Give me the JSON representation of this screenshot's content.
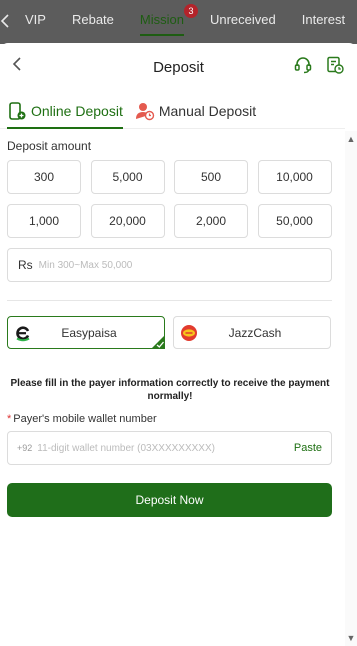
{
  "topnav": {
    "back_icon": "chevron-left-icon",
    "tabs": [
      {
        "label": "VIP"
      },
      {
        "label": "Rebate"
      },
      {
        "label": "Mission",
        "badge": "3",
        "active": true
      },
      {
        "label": "Unreceived"
      },
      {
        "label": "Interest"
      }
    ]
  },
  "header": {
    "title": "Deposit",
    "icons": [
      "headset-icon",
      "history-icon"
    ]
  },
  "method_tabs": [
    {
      "label": "Online Deposit",
      "icon": "online-deposit-icon",
      "active": true
    },
    {
      "label": "Manual Deposit",
      "icon": "manual-deposit-icon",
      "active": false
    }
  ],
  "amount": {
    "label": "Deposit amount",
    "presets": [
      "300",
      "5,000",
      "500",
      "10,000",
      "1,000",
      "20,000",
      "2,000",
      "50,000"
    ],
    "currency": "Rs",
    "placeholder": "Min 300~Max 50,000"
  },
  "channels": [
    {
      "name": "Easypaisa",
      "selected": true
    },
    {
      "name": "JazzCash",
      "selected": false
    }
  ],
  "notice": "Please fill in the payer information correctly to receive the payment normally!",
  "wallet": {
    "label": "Payer's mobile wallet number",
    "required_mark": "*",
    "prefix": "+92",
    "placeholder": "11-digit wallet number (03XXXXXXXXX)",
    "paste_label": "Paste"
  },
  "submit_label": "Deposit Now",
  "colors": {
    "accent": "#1f6e1a",
    "required": "#d33333",
    "badge": "#b4232a"
  }
}
